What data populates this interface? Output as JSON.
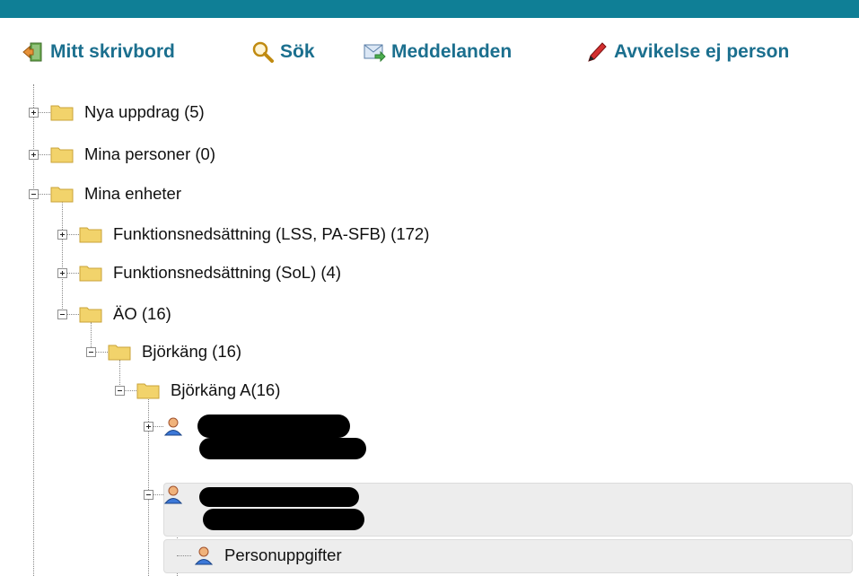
{
  "toolbar": {
    "items": [
      {
        "label": "Mitt skrivbord",
        "icon": "desk-exit-icon"
      },
      {
        "label": "Sök",
        "icon": "search-icon"
      },
      {
        "label": "Meddelanden",
        "icon": "mail-icon"
      },
      {
        "label": "Avvikelse ej person",
        "icon": "red-pen-icon"
      }
    ]
  },
  "tree": {
    "nya_uppdrag": "Nya uppdrag (5)",
    "mina_personer": "Mina personer (0)",
    "mina_enheter": "Mina enheter",
    "funk_lss": "Funktionsnedsättning (LSS, PA-SFB) (172)",
    "funk_sol": "Funktionsnedsättning (SoL) (4)",
    "ao": "ÄO (16)",
    "bjorkang": "Björkäng (16)",
    "bjorkang_a": "Björkäng A(16)",
    "personuppgifter": "Personuppgifter"
  },
  "colors": {
    "topbar": "#0f7f96",
    "toolbar_text": "#1b6f8e",
    "folder": "#f2d36b",
    "selection": "#ededed"
  }
}
